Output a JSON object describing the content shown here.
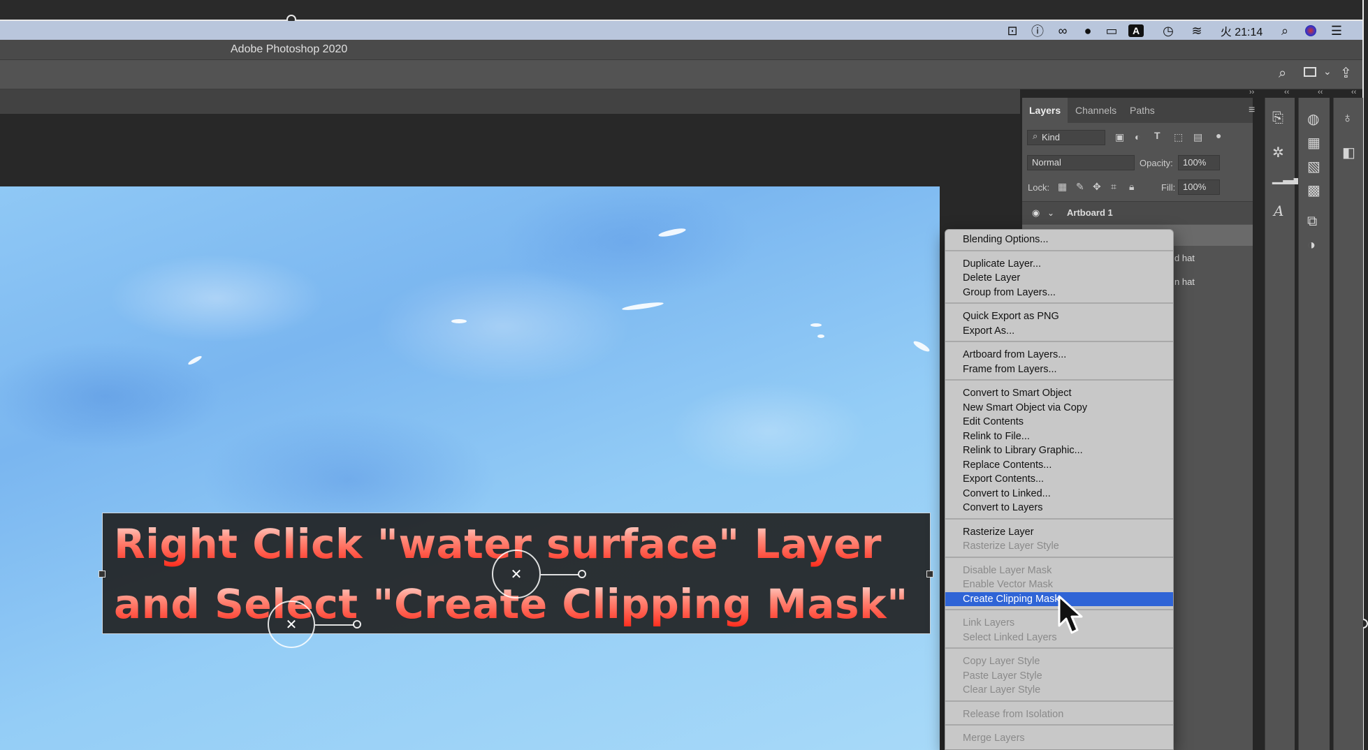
{
  "app": {
    "title": "Adobe Photoshop 2020"
  },
  "menubar": {
    "status_icons": [
      "screen-record-icon",
      "info-icon",
      "creative-cloud-icon",
      "sync-icon",
      "airplay-icon",
      "input-a-icon",
      "time-machine-icon",
      "wifi-icon"
    ],
    "clock": "火 21:14",
    "right_icons": [
      "spotlight-search-icon",
      "siri-icon",
      "control-list-icon"
    ]
  },
  "options_bar": {
    "icons": [
      "search-icon",
      "workspace-icon",
      "share-icon"
    ]
  },
  "layers_panel": {
    "tabs": [
      "Layers",
      "Channels",
      "Paths"
    ],
    "kind_filter": "Kind",
    "blend_mode": "Normal",
    "opacity_label": "Opacity:",
    "opacity_value": "100%",
    "lock_label": "Lock:",
    "fill_label": "Fill:",
    "fill_value": "100%",
    "artboard": "Artboard 1",
    "layer_partial_1": "d hat",
    "layer_partial_2": "n hat"
  },
  "caption": {
    "line1": "Right Click \"water surface\" Layer",
    "line2": "and Select \"Create Clipping Mask\""
  },
  "context_menu": {
    "groups": [
      [
        {
          "label": "Blending Options...",
          "enabled": true
        }
      ],
      [
        {
          "label": "Duplicate Layer...",
          "enabled": true
        },
        {
          "label": "Delete Layer",
          "enabled": true
        },
        {
          "label": "Group from Layers...",
          "enabled": true
        }
      ],
      [
        {
          "label": "Quick Export as PNG",
          "enabled": true
        },
        {
          "label": "Export As...",
          "enabled": true
        }
      ],
      [
        {
          "label": "Artboard from Layers...",
          "enabled": true
        },
        {
          "label": "Frame from Layers...",
          "enabled": true
        }
      ],
      [
        {
          "label": "Convert to Smart Object",
          "enabled": true
        },
        {
          "label": "New Smart Object via Copy",
          "enabled": true
        },
        {
          "label": "Edit Contents",
          "enabled": true
        },
        {
          "label": "Relink to File...",
          "enabled": true
        },
        {
          "label": "Relink to Library Graphic...",
          "enabled": true
        },
        {
          "label": "Replace Contents...",
          "enabled": true
        },
        {
          "label": "Export Contents...",
          "enabled": true
        },
        {
          "label": "Convert to Linked...",
          "enabled": true
        },
        {
          "label": "Convert to Layers",
          "enabled": true
        }
      ],
      [
        {
          "label": "Rasterize Layer",
          "enabled": true
        },
        {
          "label": "Rasterize Layer Style",
          "enabled": false
        }
      ],
      [
        {
          "label": "Disable Layer Mask",
          "enabled": false
        },
        {
          "label": "Enable Vector Mask",
          "enabled": false
        },
        {
          "label": "Create Clipping Mask",
          "enabled": true,
          "selected": true
        }
      ],
      [
        {
          "label": "Link Layers",
          "enabled": false
        },
        {
          "label": "Select Linked Layers",
          "enabled": false
        }
      ],
      [
        {
          "label": "Copy Layer Style",
          "enabled": false
        },
        {
          "label": "Paste Layer Style",
          "enabled": false
        },
        {
          "label": "Clear Layer Style",
          "enabled": false
        }
      ],
      [
        {
          "label": "Release from Isolation",
          "enabled": false
        }
      ],
      [
        {
          "label": "Merge Layers",
          "enabled": false
        }
      ]
    ],
    "highlight_color": "#2f64d6"
  }
}
